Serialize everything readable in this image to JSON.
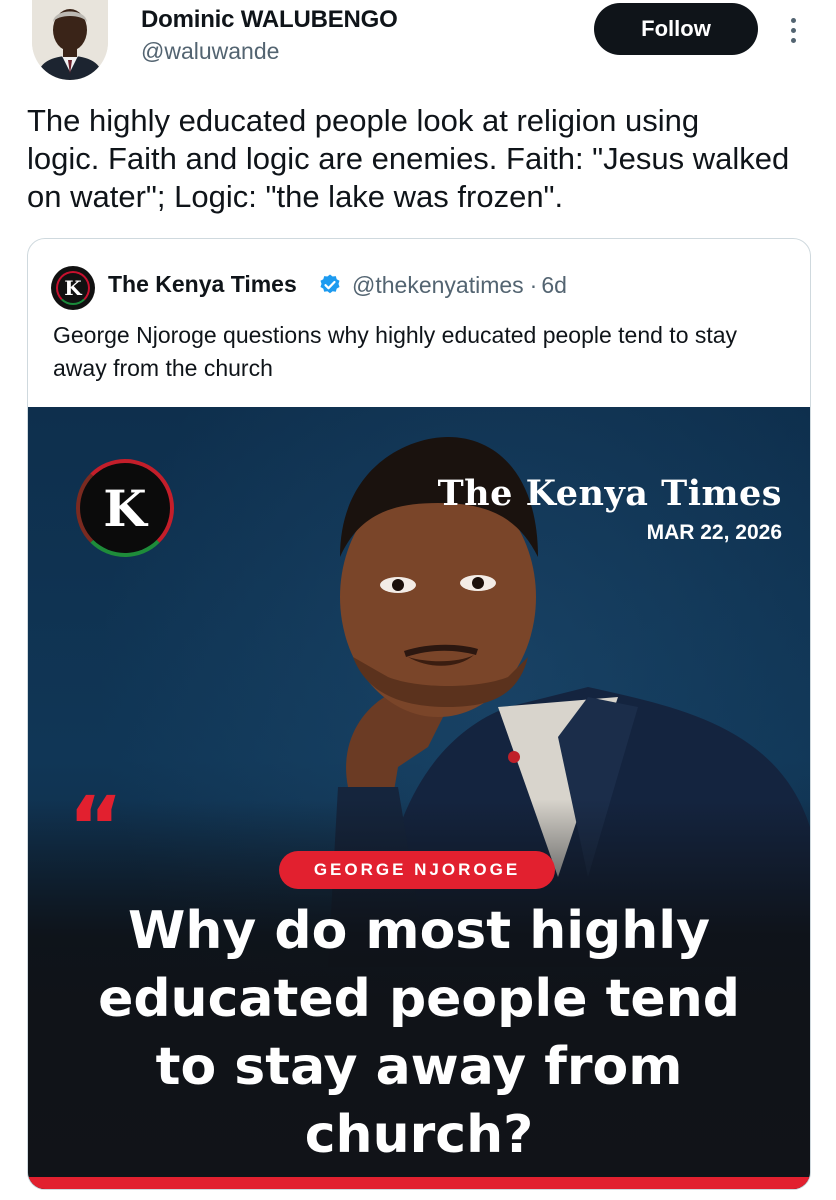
{
  "tweet": {
    "author_name": "Dominic WALUBENGO",
    "author_handle": "@waluwande",
    "follow_label": "Follow",
    "more_icon": "more-vertical-icon",
    "text": "The highly  educated people look at religion using\nlogic. Faith and logic are enemies. Faith: \"Jesus walked\non water\"; Logic: \"the lake was frozen\"."
  },
  "quoted_tweet": {
    "author_name": "The Kenya Times",
    "verified_icon": "verified-badge-icon",
    "author_handle": "@thekenyatimes",
    "separator": "·",
    "age": "6d",
    "text": "George Njoroge questions why highly educated people tend to stay away from the church",
    "media": {
      "logo_letter": "K",
      "masthead": "The Kenya Times",
      "date": "MAR 22, 2026",
      "quote_mark": "“",
      "person_label": "GEORGE NJOROGE",
      "headline": "Why do most highly\neducated people tend\nto stay away from\nchurch?"
    }
  },
  "colors": {
    "accent_red": "#e2202f",
    "follow_bg": "#0f1419",
    "verified_blue": "#1d9bf0",
    "media_bg": "#0e2f4d"
  }
}
